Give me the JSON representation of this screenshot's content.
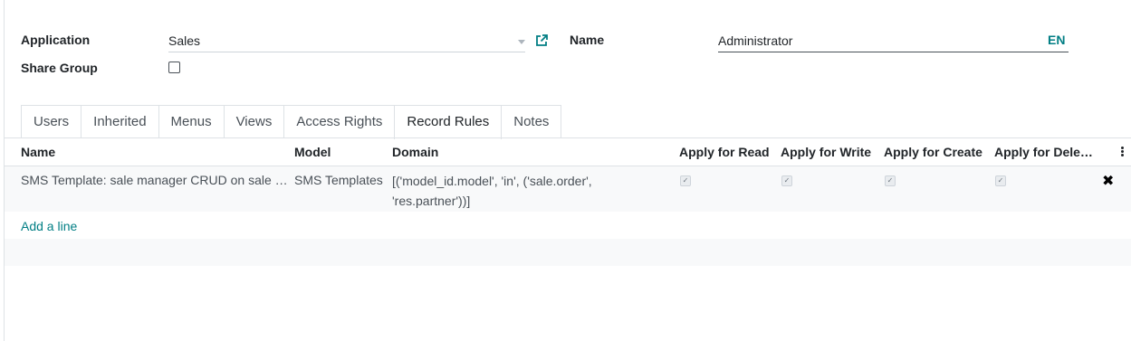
{
  "form": {
    "application_label": "Application",
    "application_value": "Sales",
    "share_group_label": "Share Group",
    "share_group_checked": false,
    "name_label": "Name",
    "name_value": "Administrator",
    "lang_badge": "EN"
  },
  "tabs": [
    {
      "label": "Users",
      "active": false
    },
    {
      "label": "Inherited",
      "active": false
    },
    {
      "label": "Menus",
      "active": false
    },
    {
      "label": "Views",
      "active": false
    },
    {
      "label": "Access Rights",
      "active": false
    },
    {
      "label": "Record Rules",
      "active": true
    },
    {
      "label": "Notes",
      "active": false
    }
  ],
  "table": {
    "columns": [
      "Name",
      "Model",
      "Domain",
      "Apply for Read",
      "Apply for Write",
      "Apply for Create",
      "Apply for Dele…"
    ],
    "rows": [
      {
        "name": "SMS Template: sale manager CRUD on sale …",
        "model": "SMS Templates",
        "domain": "[('model_id.model', 'in', ('sale.order', 'res.partner'))]",
        "read": true,
        "write": true,
        "create": true,
        "delete": true
      }
    ],
    "add_line_label": "Add a line"
  },
  "icons": {
    "external_link": "external-link-icon",
    "dropdown": "caret-down-icon",
    "delete": "close-icon",
    "options": "kebab-menu-icon"
  },
  "colors": {
    "accent": "#017e84",
    "text": "#212529",
    "muted": "#495057"
  }
}
